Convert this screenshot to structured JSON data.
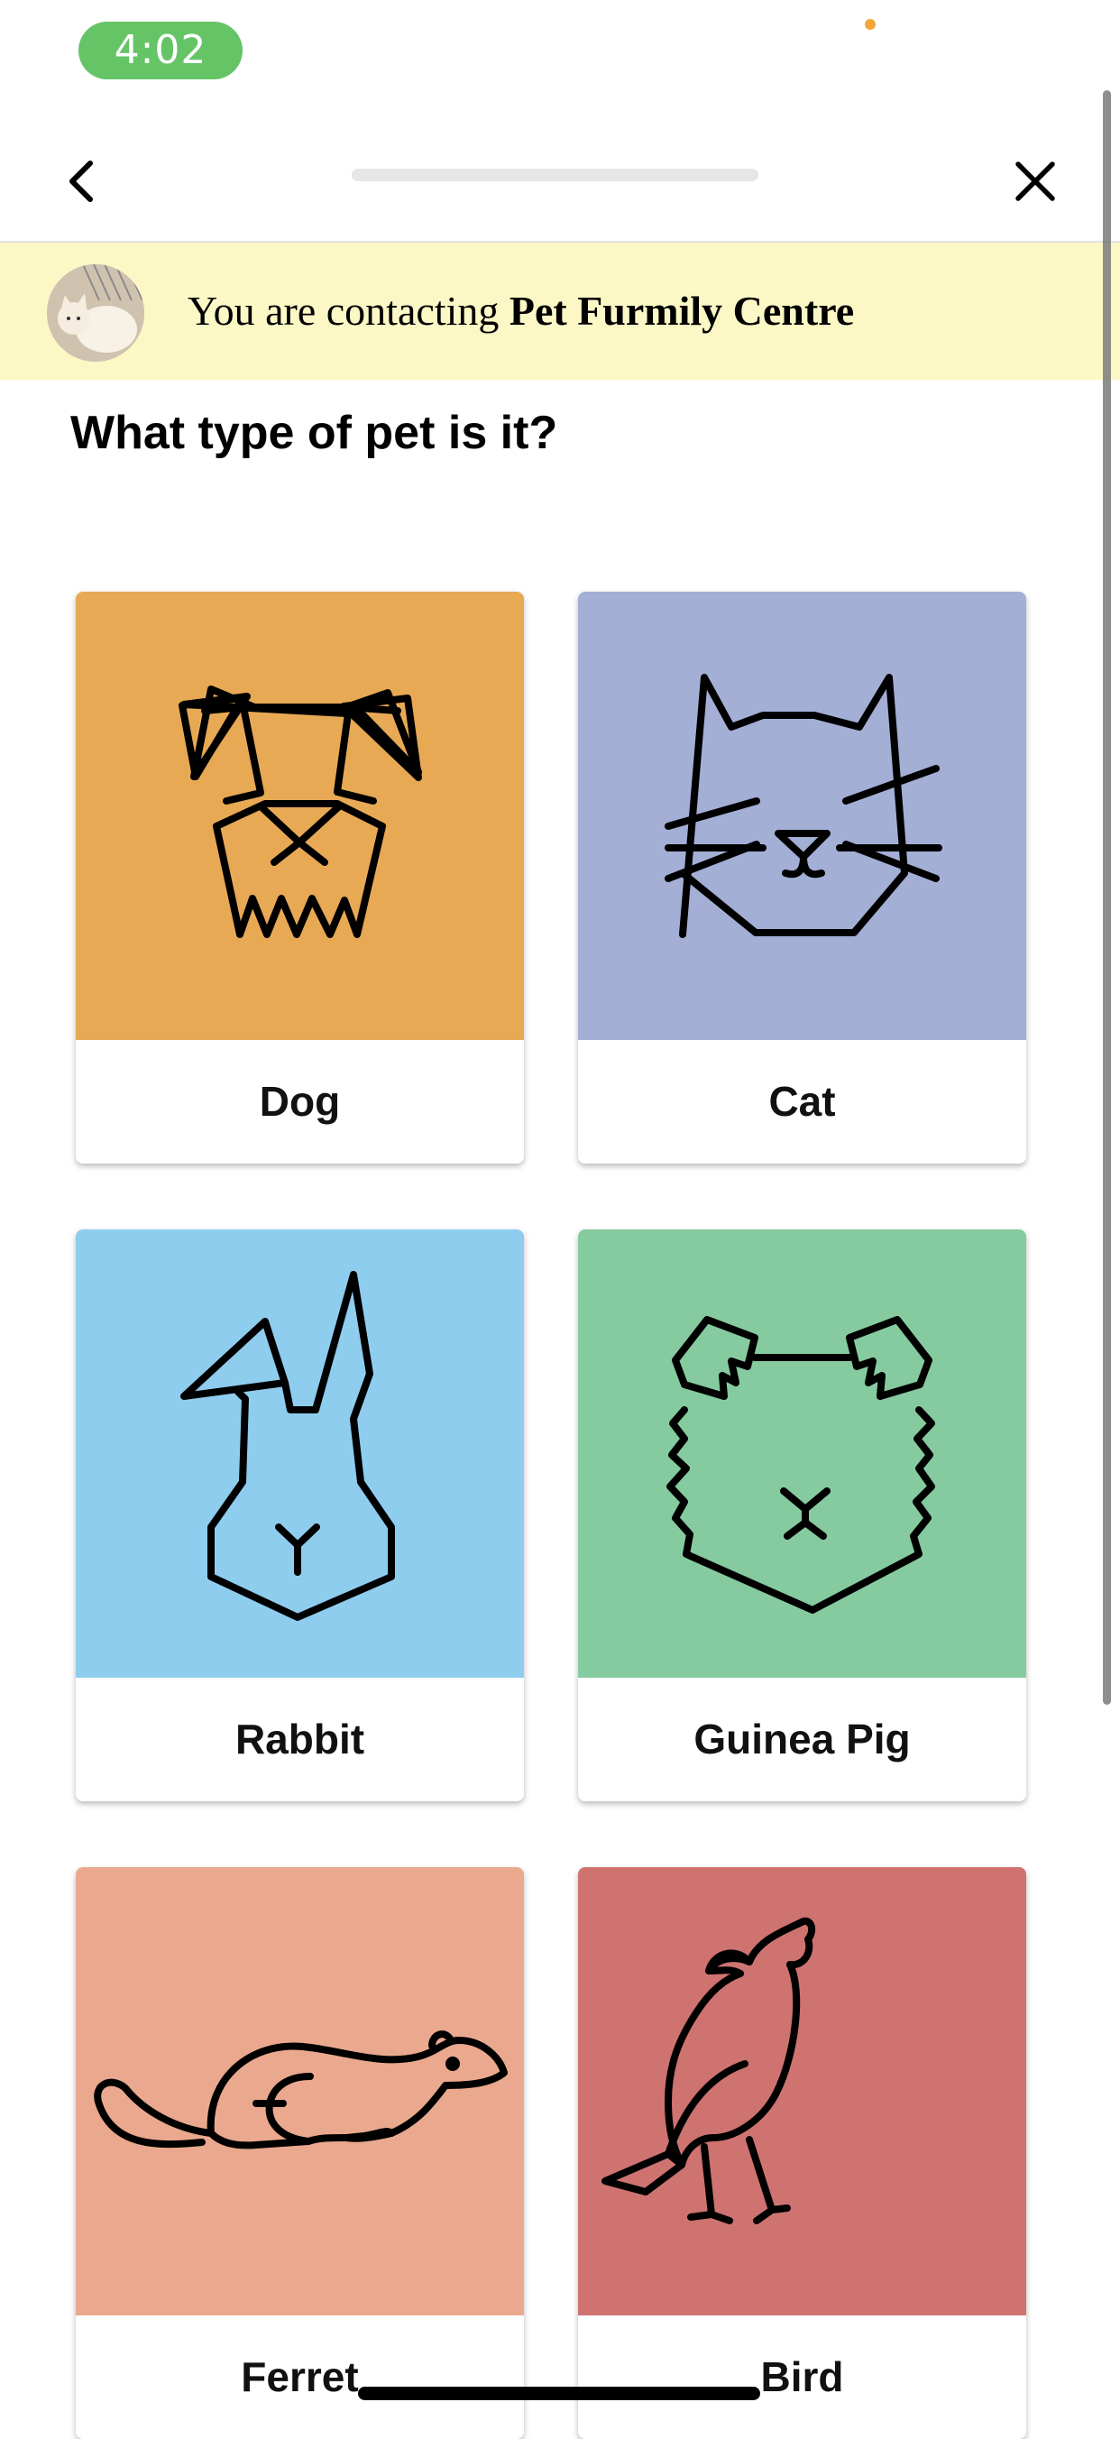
{
  "status_bar": {
    "time": "4:02"
  },
  "nav": {
    "back_icon": "chevron-left-icon",
    "close_icon": "close-icon"
  },
  "banner": {
    "prefix": "You are contacting ",
    "business_name": "Pet Furmily Centre",
    "color": "#fcf8c6"
  },
  "question": "What type of pet is it?",
  "pets": [
    {
      "label": "Dog",
      "icon": "dog-icon",
      "color": "#e8a955"
    },
    {
      "label": "Cat",
      "icon": "cat-icon",
      "color": "#a4afd6"
    },
    {
      "label": "Rabbit",
      "icon": "rabbit-icon",
      "color": "#8fcdee"
    },
    {
      "label": "Guinea Pig",
      "icon": "guinea-pig-icon",
      "color": "#85cb9f"
    },
    {
      "label": "Ferret",
      "icon": "ferret-icon",
      "color": "#eaa98e"
    },
    {
      "label": "Bird",
      "icon": "bird-icon",
      "color": "#cf7371"
    }
  ]
}
